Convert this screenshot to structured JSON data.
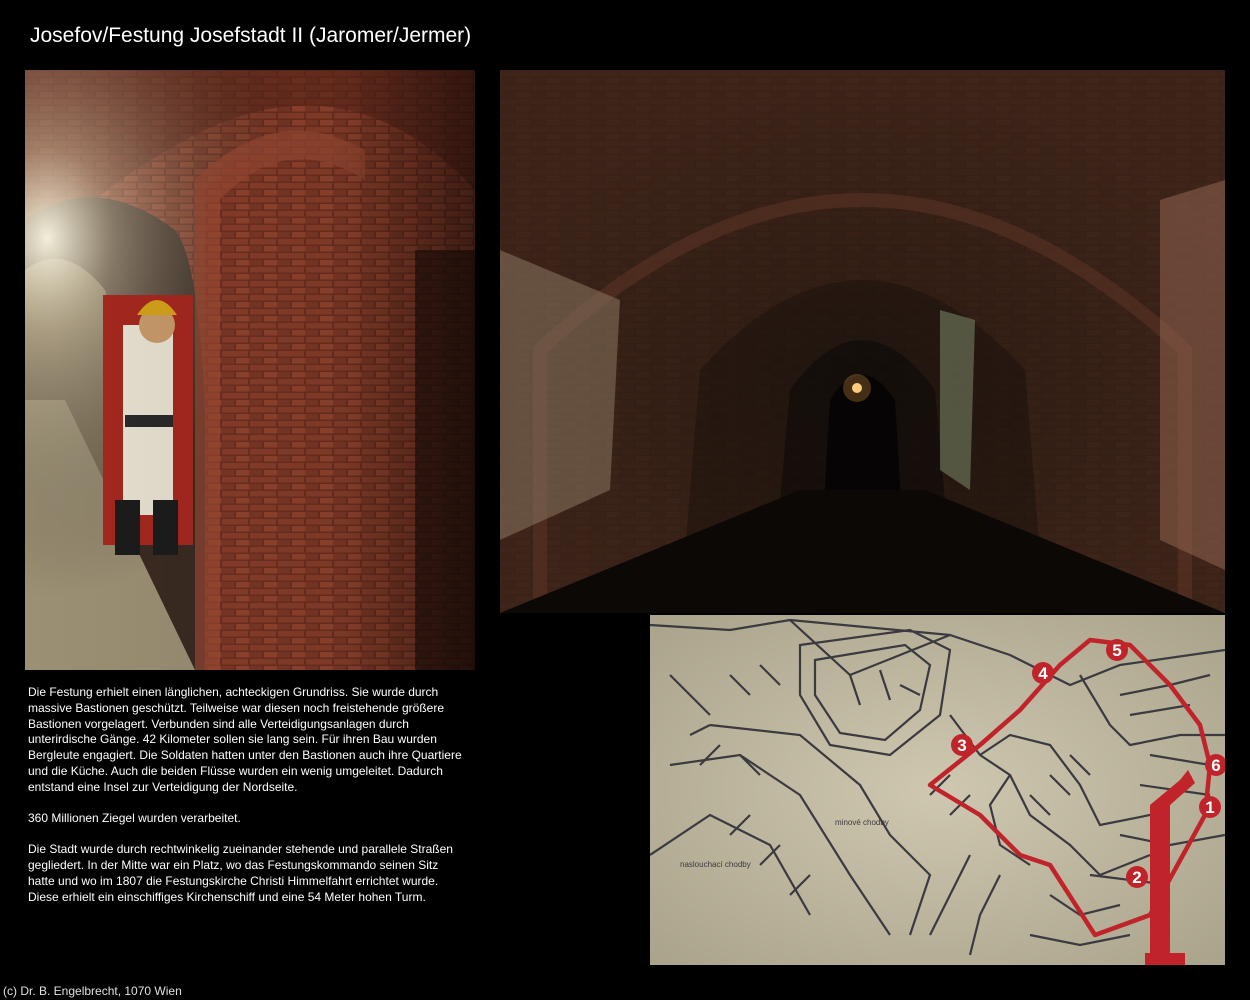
{
  "page": {
    "title": "Josefov/Festung Josefstadt II (Jaromer/Jermer)",
    "footer": "(c) Dr. B. Engelbrecht, 1070 Wien"
  },
  "description": {
    "paragraphs": [
      "Die Festung erhielt einen länglichen, achteckigen Grundriss. Sie wurde durch massive Bastionen geschützt. Teilweise war diesen noch freistehende größere Bastionen vorgelagert. Verbunden sind alle Verteidigungsanlagen durch unterirdische Gänge. 42 Kilometer sollen sie lang sein. Für ihren Bau wurden Bergleute engagiert. Die Soldaten hatten unter den Bastionen auch ihre Quartiere und die Küche. Auch die beiden Flüsse wurden ein wenig umgeleitet. Dadurch entstand eine Insel zur Verteidigung der Nordseite.",
      "360 Millionen Ziegel wurden verarbeitet.",
      "Die Stadt wurde durch rechtwinkelig zueinander stehende und parallele Straßen gegliedert. In der Mitte war ein Platz, wo das Festungskommando seinen Sitz hatte und wo im 1807 die Festungskirche Christi Himmelfahrt errichtet wurde. Diese erhielt ein einschiffiges Kirchenschiff und eine 54 Meter hohen Turm."
    ]
  },
  "map": {
    "labels": [
      "minové chodby",
      "naslouchací chodby"
    ],
    "route_markers": [
      "1",
      "2",
      "3",
      "4",
      "5",
      "6"
    ],
    "route_color": "#c0242a",
    "paper_color": "#c9c2ab",
    "line_color": "#3a3a40"
  },
  "colors": {
    "background": "#000000",
    "brick": "#7a3524",
    "text": "#ffffff"
  }
}
